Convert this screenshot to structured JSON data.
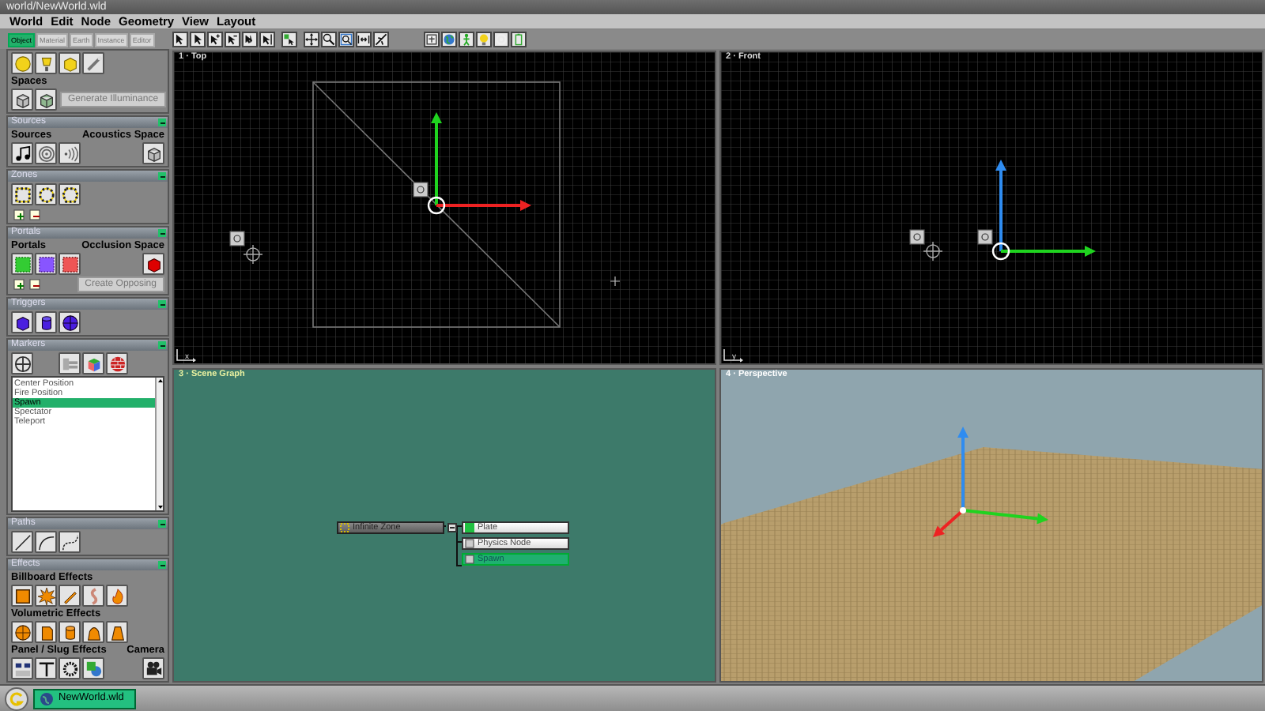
{
  "window": {
    "title": "world/NewWorld.wld"
  },
  "menu": [
    "World",
    "Edit",
    "Node",
    "Geometry",
    "View",
    "Layout"
  ],
  "tabs": [
    {
      "label": "Object",
      "selected": true
    },
    {
      "label": "Material",
      "selected": false
    },
    {
      "label": "Earth",
      "selected": false
    },
    {
      "label": "Instance",
      "selected": false
    },
    {
      "label": "Editor",
      "selected": false
    }
  ],
  "sidebar": {
    "panels": [
      {
        "kind": "lights",
        "labels": [
          "Spaces"
        ],
        "button": "Generate Illuminance"
      },
      {
        "kind": "sources",
        "title": "Sources",
        "expanded": true,
        "labels": [
          "Sources",
          "Acoustics Space"
        ]
      },
      {
        "kind": "zones",
        "title": "Zones",
        "expanded": true
      },
      {
        "kind": "portals",
        "title": "Portals",
        "expanded": true,
        "labels": [
          "Portals",
          "Occlusion Space"
        ],
        "button": "Create Opposing"
      },
      {
        "kind": "triggers",
        "title": "Triggers",
        "expanded": true
      },
      {
        "kind": "markers",
        "title": "Markers",
        "expanded": true,
        "list": [
          {
            "label": "Center Position",
            "selected": false
          },
          {
            "label": "Fire Position",
            "selected": false
          },
          {
            "label": "Spawn",
            "selected": true
          },
          {
            "label": "Spectator",
            "selected": false
          },
          {
            "label": "Teleport",
            "selected": false
          }
        ]
      },
      {
        "kind": "paths",
        "title": "Paths",
        "expanded": true
      },
      {
        "kind": "effects",
        "title": "Effects",
        "expanded": true,
        "labels": [
          "Billboard Effects",
          "Volumetric Effects",
          "Panel / Slug Effects",
          "Camera"
        ]
      }
    ]
  },
  "viewports": [
    {
      "kind": "top",
      "title": "1 · Top",
      "axis": "x"
    },
    {
      "kind": "front",
      "title": "2 · Front",
      "axis": "y"
    },
    {
      "kind": "graph",
      "title": "3 · Scene Graph"
    },
    {
      "kind": "perspective",
      "title": "4 · Perspective"
    }
  ],
  "scene_graph": {
    "root": {
      "label": "Infinite Zone",
      "expanded": true,
      "children": [
        {
          "label": "Plate",
          "selected": false
        },
        {
          "label": "Physics Node",
          "selected": false
        },
        {
          "label": "Spawn",
          "selected": true
        }
      ]
    }
  },
  "taskbar": {
    "items": [
      {
        "label": "NewWorld.wld",
        "selected": true
      }
    ]
  }
}
